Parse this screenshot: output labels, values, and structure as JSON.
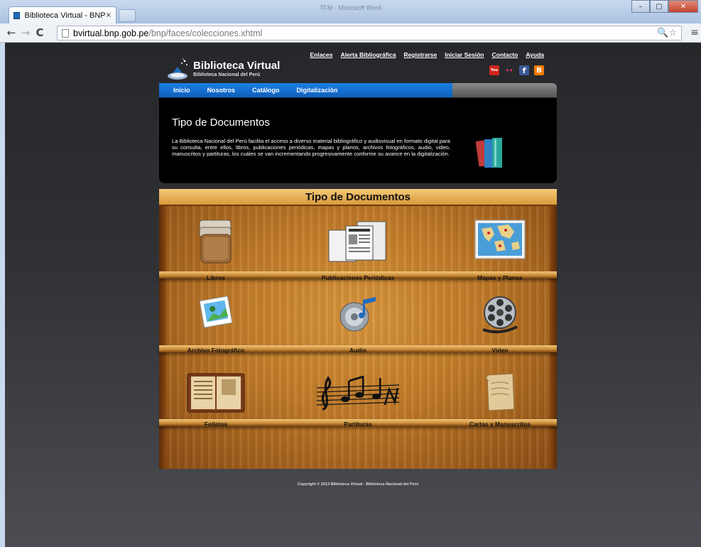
{
  "browser": {
    "tab_title": "Biblioteca Virtual - BNP",
    "tab_close": "×",
    "window_caption": "TFM - Microsoft Word",
    "url_host": "bvirtual.bnp.gob.pe",
    "url_path": "/bnp/faces/colecciones.xhtml",
    "back": "←",
    "forward": "→",
    "reload": "C",
    "zoom_star": "🔍☆",
    "menu": "≡"
  },
  "header": {
    "title": "Biblioteca Virtual",
    "subtitle": "Biblioteca Nacional del Perú",
    "links": [
      "Enlaces",
      "Alerta Bibliográfica",
      "Registrarse",
      "Iniciar Sesión",
      "Contacto",
      "Ayuda"
    ],
    "socials": [
      {
        "name": "youtube-icon",
        "glyph": "You",
        "color": "#d2251c"
      },
      {
        "name": "flickr-icon",
        "glyph": "••",
        "color": "#2b2b2b"
      },
      {
        "name": "facebook-icon",
        "glyph": "f",
        "color": "#3b5998"
      },
      {
        "name": "blogger-icon",
        "glyph": "B",
        "color": "#f57d00"
      }
    ]
  },
  "nav": {
    "items": [
      "Inicio",
      "Nosotros",
      "Catálogo",
      "Digitalización"
    ]
  },
  "intro": {
    "title": "Tipo de Documentos",
    "text": "La Biblioteca Nacional del Perú facilita el acceso a diverso material bibliográfico y audiovisual en formato digital para su consulta, entre ellos, libros, publicaciones periódicas, mapas y planos, archivos fotográficos, audio, video, manuscritos y partituras, los cuáles se van incrementando progresivamente conforme su avance en la digitalización."
  },
  "shelf": {
    "title": "Tipo de Documentos",
    "items": [
      "Libros",
      "Publicaciones Periódicas",
      "Mapas y Planos",
      "Archivo Fotográfico",
      "Audio",
      "Video",
      "Folletos",
      "Partituras",
      "Cartas y Manuscritos"
    ]
  },
  "footer": {
    "copyright": "Copyright © 2013 Biblioteca Virtual - Biblioteca Nacional del Perú"
  }
}
